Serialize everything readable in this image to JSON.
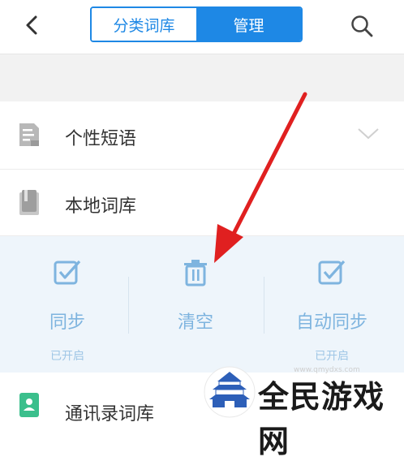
{
  "header": {
    "tabs": [
      {
        "label": "分类词库",
        "active": false
      },
      {
        "label": "管理",
        "active": true
      }
    ]
  },
  "list": {
    "items": [
      {
        "label": "个性短语",
        "icon": "phrase-icon"
      },
      {
        "label": "本地词库",
        "icon": "book-icon"
      },
      {
        "label": "通讯录词库",
        "icon": "contacts-icon"
      }
    ]
  },
  "panel": {
    "actions": [
      {
        "label": "同步",
        "status": "已开启",
        "icon": "checkbox-icon"
      },
      {
        "label": "清空",
        "status": "",
        "icon": "trash-icon"
      },
      {
        "label": "自动同步",
        "status": "已开启",
        "icon": "checkbox-icon"
      }
    ]
  },
  "watermark": {
    "text": "全民游戏网",
    "url": "www.qmydxs.com"
  },
  "colors": {
    "accent": "#1e88e5",
    "panel_bg": "#eef5fb",
    "action_text": "#7eb4df",
    "arrow": "#e02020"
  }
}
